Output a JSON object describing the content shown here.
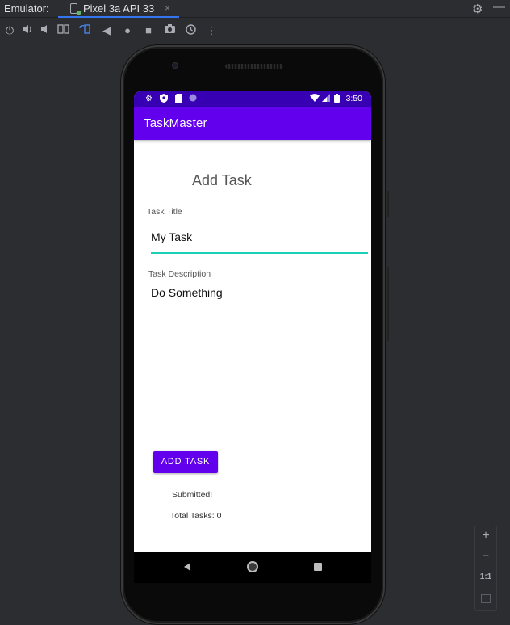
{
  "emulator": {
    "label": "Emulator:",
    "tab_label": "Pixel 3a API 33",
    "tab_close": "×"
  },
  "toolbar": {
    "icons": [
      "power-icon",
      "volume-up-icon",
      "volume-down-icon",
      "rotate-left-icon",
      "rotate-right-icon",
      "back-icon",
      "home-icon",
      "overview-icon",
      "screenshot-icon",
      "snapshot-icon",
      "more-icon"
    ]
  },
  "zoom": {
    "plus": "+",
    "minus": "−",
    "one_to_one": "1:1"
  },
  "status_bar": {
    "time": "3:50"
  },
  "app": {
    "title": "TaskMaster",
    "heading": "Add Task",
    "title_label": "Task Title",
    "title_value": "My Task",
    "description_label": "Task Description",
    "description_value": "Do Something",
    "add_button": "ADD TASK",
    "submitted": "Submitted!",
    "total_tasks": "Total Tasks: 0"
  },
  "colors": {
    "status_bar": "#3700b3",
    "primary": "#6200ee",
    "focus_underline": "#1ad1b8"
  }
}
